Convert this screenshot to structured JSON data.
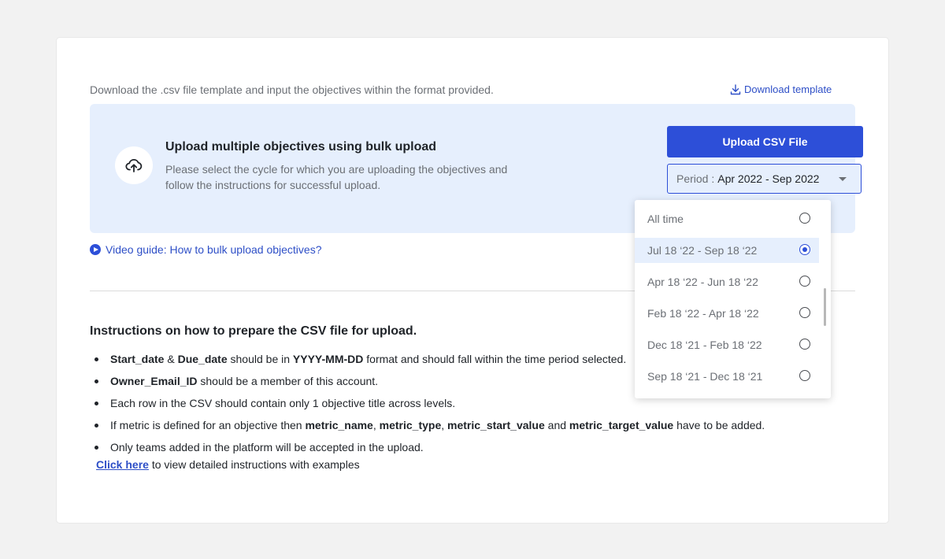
{
  "intro": {
    "text": "Download the .csv file template and input the objectives within the format provided.",
    "download_label": "Download template"
  },
  "upload_box": {
    "title": "Upload multiple objectives using bulk upload",
    "description": "Please select the cycle for which you are uploading the objectives and follow the instructions for successful upload.",
    "button_label": "Upload CSV File",
    "period_label": "Period :",
    "period_value": "Apr 2022 - Sep 2022"
  },
  "video_guide": "Video guide: How to bulk upload objectives?",
  "instructions": {
    "title": "Instructions on how to prepare the CSV file for upload.",
    "items": [
      {
        "b1": "Start_date",
        "t1": " & ",
        "b2": "Due_date",
        "t2": " should be in ",
        "b3": "YYYY-MM-DD",
        "t3": " format and should fall within the time period selected."
      },
      {
        "b1": "Owner_Email_ID",
        "t1": " should be a member of this account."
      },
      {
        "t0": "Each row in the CSV should contain only 1 objective title across levels."
      },
      {
        "t0": "If metric is defined for an objective then ",
        "b1": "metric_name",
        "t1": ", ",
        "b2": "metric_type",
        "t2": ", ",
        "b3": "metric_start_value",
        "t3": " and ",
        "b4": "metric_target_value",
        "t4": " have to be added."
      },
      {
        "t0": "Only teams added in the platform will be accepted in the upload."
      }
    ],
    "click_here": "Click here",
    "click_suffix": " to view detailed instructions with examples"
  },
  "dropdown": {
    "options": [
      {
        "label": "All time",
        "selected": false
      },
      {
        "label": "Jul 18 ‘22 - Sep 18 ‘22",
        "selected": true
      },
      {
        "label": "Apr 18 ‘22 - Jun 18 ‘22",
        "selected": false
      },
      {
        "label": "Feb 18 ‘22 - Apr 18 ‘22",
        "selected": false
      },
      {
        "label": "Dec 18 ‘21 - Feb 18 ‘22",
        "selected": false
      },
      {
        "label": "Sep 18 ‘21 - Dec 18 ‘21",
        "selected": false
      }
    ]
  },
  "colors": {
    "accent": "#2d4fd8",
    "link": "#2e4fc7",
    "panel_bg": "#e6effd"
  }
}
